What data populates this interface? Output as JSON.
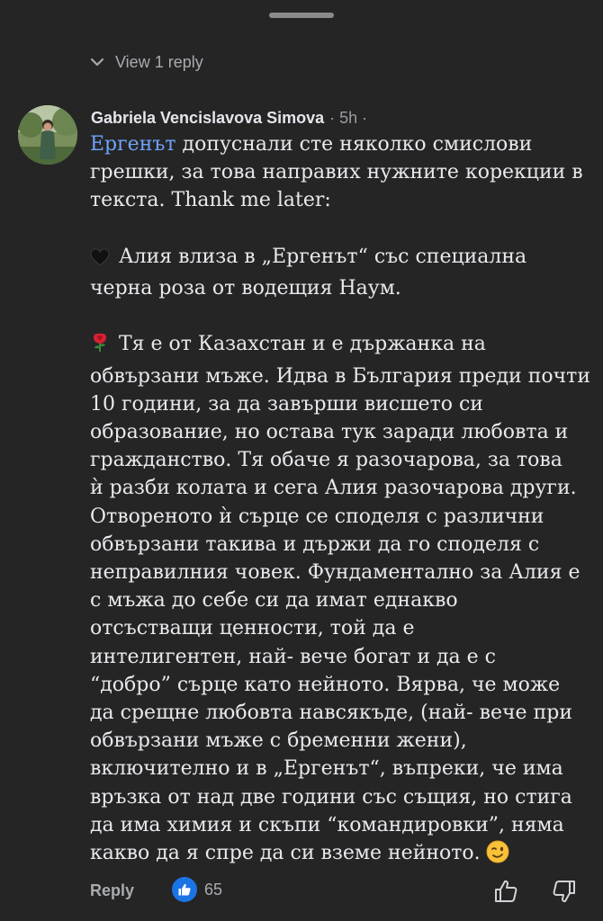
{
  "thread": {
    "view_replies_label": "View 1 reply"
  },
  "comment": {
    "author": "Gabriela Vencislavova Simova",
    "meta": "· 5h ·",
    "mention": "Ергенът",
    "lines": {
      "p1_l1_rest": " допуснали сте няколко смислови",
      "p1_l2": "грешки, за това направих нужните корекции в",
      "p1_l3": "текста. Thank me later:",
      "p2_l1": "Алия влиза в „Ергенът“ със специална",
      "p2_l2": "черна роза от водещия Наум.",
      "p3_l1": "Тя е от Казахстан и е държанка на",
      "p3_l2": "обвързани мъже. Идва в България преди почти",
      "p3_l3": "10 години, за да завърши висшето си",
      "p3_l4": "образование, но остава тук заради любовта и",
      "p3_l5": "гражданство. Тя обаче я разочарова, за това",
      "p3_l6": "ѝ разби колата  и сега Алия разочарова други.",
      "p3_l7": "Отвореното ѝ сърце се споделя с различни",
      "p3_l8": "обвързани такива и държи да го споделя с",
      "p3_l9": "неправилния човек. Фундаментално за Алия е",
      "p3_l10": "с мъжа до себе си да имат еднакво",
      "p3_l11": "отсъстващи ценности, той да е",
      "p3_l12": "интелигентен, най- вече богат и да е с",
      "p3_l13": "“добро” сърце като нейното. Вярва, че може",
      "p3_l14": "да срещне любовта навсякъде, (най- вече при",
      "p3_l15": "обвързани мъже с бременни жени),",
      "p3_l16": "включително и в „Ергенът“, въпреки, че има",
      "p3_l17": "връзка от над две години със същия, но стига",
      "p3_l18": "да има химия и скъпи “командировки”, няма",
      "p3_l19": "какво да я спре да си вземе нейното."
    },
    "emojis": [
      "black-heart",
      "rose",
      "winking-face"
    ]
  },
  "actions": {
    "reply_label": "Reply",
    "reaction_count": "65",
    "reaction_type": "like"
  },
  "colors": {
    "background": "#252526",
    "mention": "#6fa3f7",
    "like_badge": "#1b74e4"
  }
}
